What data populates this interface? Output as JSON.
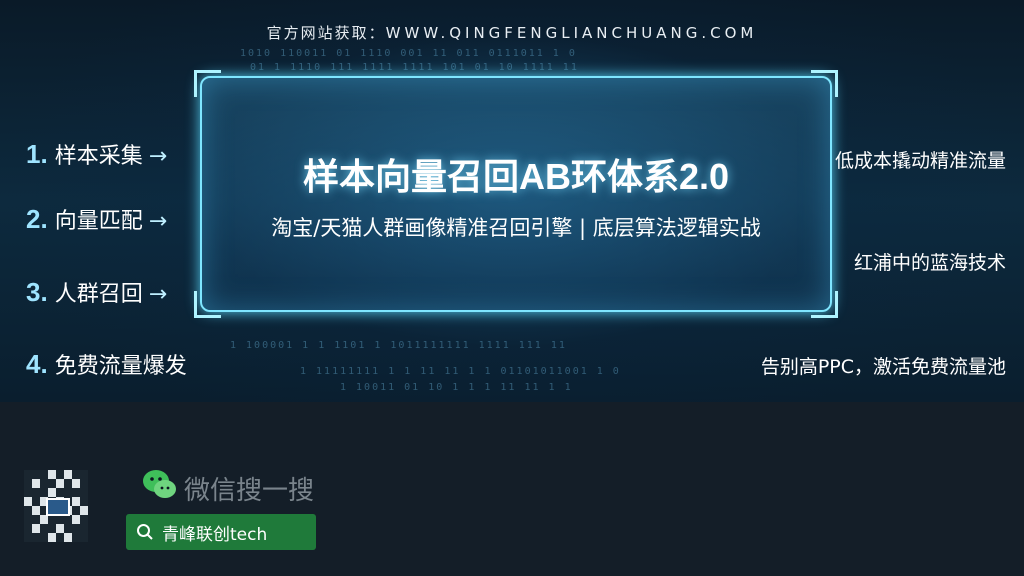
{
  "header": {
    "source_label": "官方网站获取：",
    "source_url": "WWW.QINGFENGLIANCHUANG.COM"
  },
  "panel": {
    "title": "样本向量召回AB环体系2.0",
    "subtitle": "淘宝/天猫人群画像精准召回引擎 | 底层算法逻辑实战"
  },
  "left_steps": [
    {
      "num": "1.",
      "label": "样本采集",
      "arrow": "→"
    },
    {
      "num": "2.",
      "label": "向量匹配",
      "arrow": "→"
    },
    {
      "num": "3.",
      "label": "人群召回",
      "arrow": "→"
    },
    {
      "num": "4.",
      "label": "免费流量爆发",
      "arrow": ""
    }
  ],
  "right_points": [
    "低成本撬动精准流量",
    "红浦中的蓝海技术",
    "告别高PPC，激活免费流量池"
  ],
  "footer": {
    "wechat_label": "微信搜一搜",
    "search_text": "青峰联创tech",
    "wechat_icon": "wechat-icon",
    "search_icon": "search-icon"
  },
  "colors": {
    "accent_cyan": "#7fe6ff",
    "search_green": "#1f7a3a"
  }
}
